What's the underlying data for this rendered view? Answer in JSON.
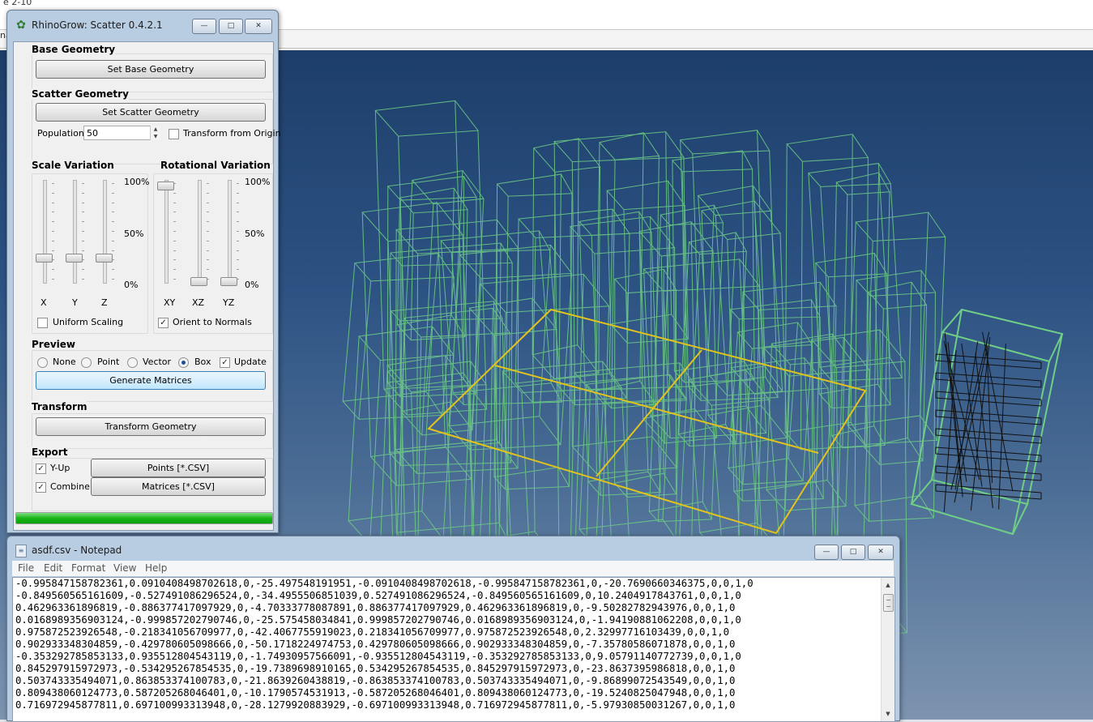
{
  "background_app": {
    "cut_title": "e 2-10",
    "left_letter": "na"
  },
  "rhinogrow": {
    "title": "RhinoGrow: Scatter 0.4.2.1",
    "window_buttons": {
      "minimize": "—",
      "maximize": "□",
      "close": "✕"
    },
    "base_geometry": {
      "title": "Base Geometry",
      "button": "Set Base Geometry"
    },
    "scatter_geometry": {
      "title": "Scatter Geometry",
      "button": "Set Scatter Geometry",
      "population_label": "Population",
      "population_value": "50",
      "transform_from_origin_label": "Transform from Origin",
      "transform_from_origin_checked": false
    },
    "scale_variation": {
      "title": "Scale Variation",
      "ticks": [
        "100%",
        "50%",
        "0%"
      ],
      "axes": [
        "X",
        "Y",
        "Z"
      ],
      "values": [
        0.25,
        0.25,
        0.25
      ],
      "uniform_scaling_label": "Uniform Scaling",
      "uniform_scaling_checked": false
    },
    "rotational_variation": {
      "title": "Rotational Variation",
      "ticks": [
        "100%",
        "50%",
        "0%"
      ],
      "axes": [
        "XY",
        "XZ",
        "YZ"
      ],
      "values": [
        1.0,
        0.0,
        0.0
      ],
      "orient_label": "Orient to Normals",
      "orient_checked": true
    },
    "preview": {
      "title": "Preview",
      "options": [
        "None",
        "Point",
        "Vector",
        "Box"
      ],
      "selected": "Box",
      "update_label": "Update",
      "update_checked": true,
      "button": "Generate Matrices"
    },
    "transform": {
      "title": "Transform",
      "button": "Transform Geometry"
    },
    "export": {
      "title": "Export",
      "yup_label": "Y-Up",
      "yup_checked": true,
      "combine_label": "Combine",
      "combine_checked": true,
      "points_button": "Points [*.CSV]",
      "matrices_button": "Matrices [*.CSV]"
    },
    "progress": 1.0
  },
  "notepad": {
    "title": "asdf.csv - Notepad",
    "window_buttons": {
      "minimize": "—",
      "maximize": "□",
      "close": "✕"
    },
    "menu": [
      "File",
      "Edit",
      "Format",
      "View",
      "Help"
    ],
    "lines": [
      "-0.995847158782361,0.0910408498702618,0,-25.497548191951,-0.0910408498702618,-0.995847158782361,0,-20.7690660346375,0,0,1,0",
      "-0.849560565161609,-0.527491086296524,0,-34.4955506851039,0.527491086296524,-0.849560565161609,0,10.2404917843761,0,0,1,0",
      "0.462963361896819,-0.886377417097929,0,-4.70333778087891,0.886377417097929,0.462963361896819,0,-9.50282782943976,0,0,1,0",
      "0.0168989356903124,-0.999857202790746,0,-25.575458034841,0.999857202790746,0.0168989356903124,0,-1.94190881062208,0,0,1,0",
      "0.975872523926548,-0.218341056709977,0,-42.4067755919023,0.218341056709977,0.975872523926548,0,2.32997716103439,0,0,1,0",
      "0.902933348304859,-0.429780605098666,0,-50.1718224974753,0.429780605098666,0.902933348304859,0,-7.35780586071878,0,0,1,0",
      "-0.353292785853133,0.935512804543119,0,-1.74930957566091,-0.935512804543119,-0.353292785853133,0,9.05791140772739,0,0,1,0",
      "0.845297915972973,-0.534295267854535,0,-19.7389698910165,0.534295267854535,0.845297915972973,0,-23.8637395986818,0,0,1,0",
      "0.503743335494071,0.863853374100783,0,-21.8639260438819,-0.863853374100783,0.503743335494071,0,-9.86899072543549,0,0,1,0",
      "0.809438060124773,0.587205268046401,0,-10.1790574531913,-0.587205268046401,0.809438060124773,0,-19.5240825047948,0,0,1,0",
      "0.716972945877811,0.697100993313948,0,-28.1279920883929,-0.697100993313948,0.716972945877811,0,-5.97930850031267,0,0,1,0"
    ]
  },
  "colors": {
    "wireframe": "#6fcf86",
    "base_outline": "#e2c41c",
    "scatter_object": "#111111",
    "progress": "#18b418"
  }
}
